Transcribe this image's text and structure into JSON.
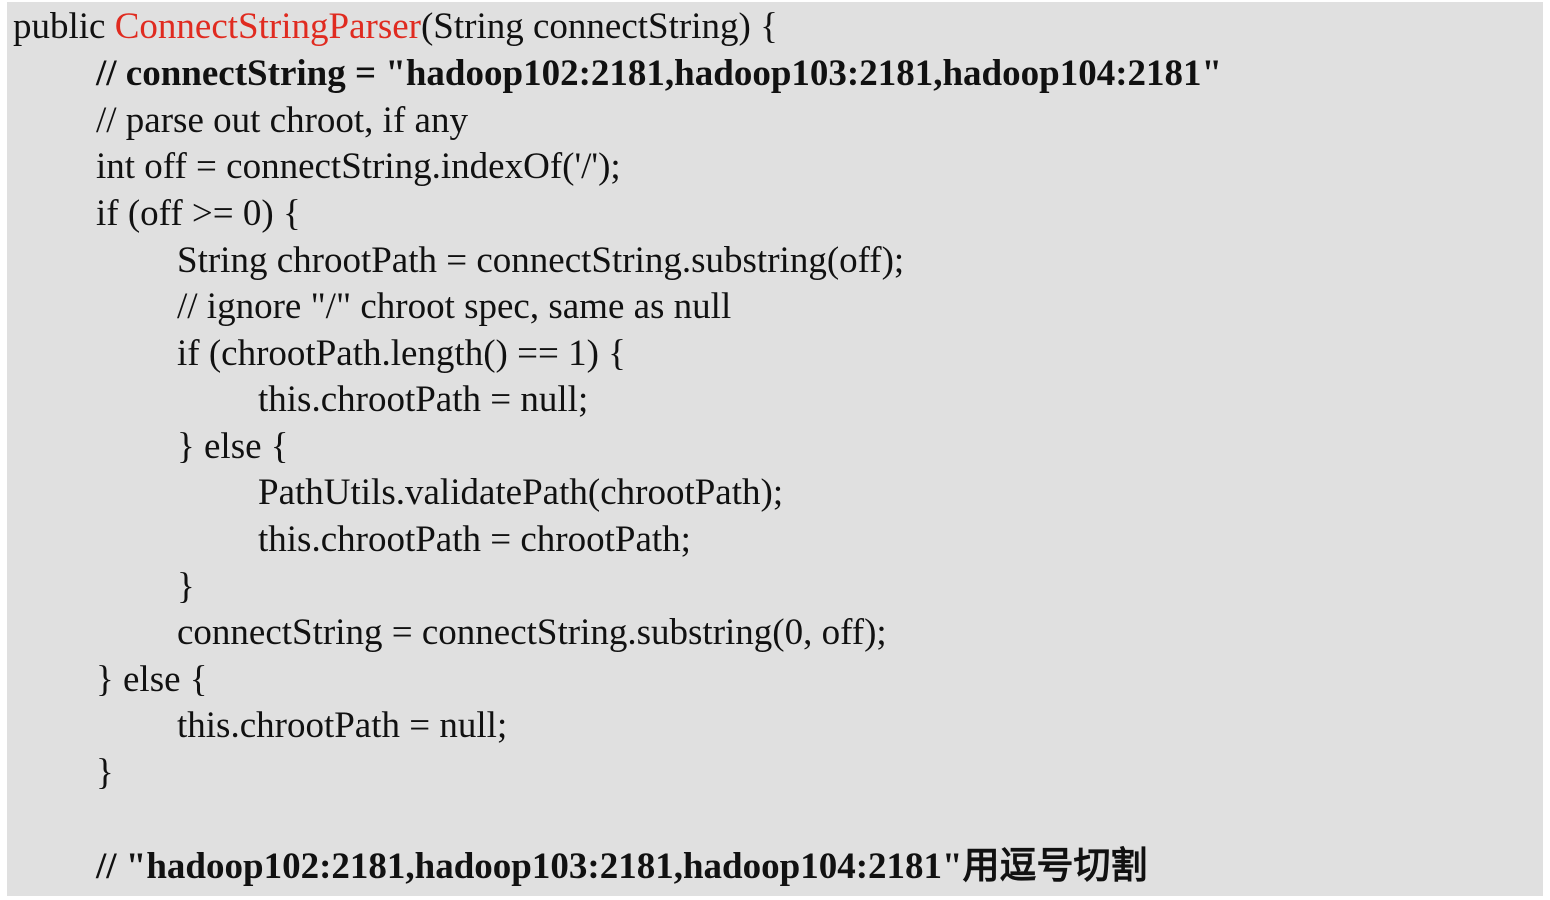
{
  "code": {
    "signature": {
      "keyword": "public ",
      "method_name": "ConnectStringParser",
      "params": "(String connectString) {"
    },
    "lines": [
      "// connectString = \"hadoop102:2181,hadoop103:2181,hadoop104:2181\"",
      "// parse out chroot, if any",
      "int off = connectString.indexOf('/');",
      "if (off >= 0) {",
      "String chrootPath = connectString.substring(off);",
      "// ignore \"/\" chroot spec, same as null",
      "if (chrootPath.length() == 1) {",
      "this.chrootPath = null;",
      "} else {",
      "PathUtils.validatePath(chrootPath);",
      "this.chrootPath = chrootPath;",
      "}",
      "connectString = connectString.substring(0, off);",
      "} else {",
      "this.chrootPath = null;",
      "}",
      "// \"hadoop102:2181,hadoop103:2181,hadoop104:2181\"用逗号切割"
    ]
  },
  "colors": {
    "background": "#e0e0e0",
    "text": "#111111",
    "method_highlight": "#e02b20"
  }
}
